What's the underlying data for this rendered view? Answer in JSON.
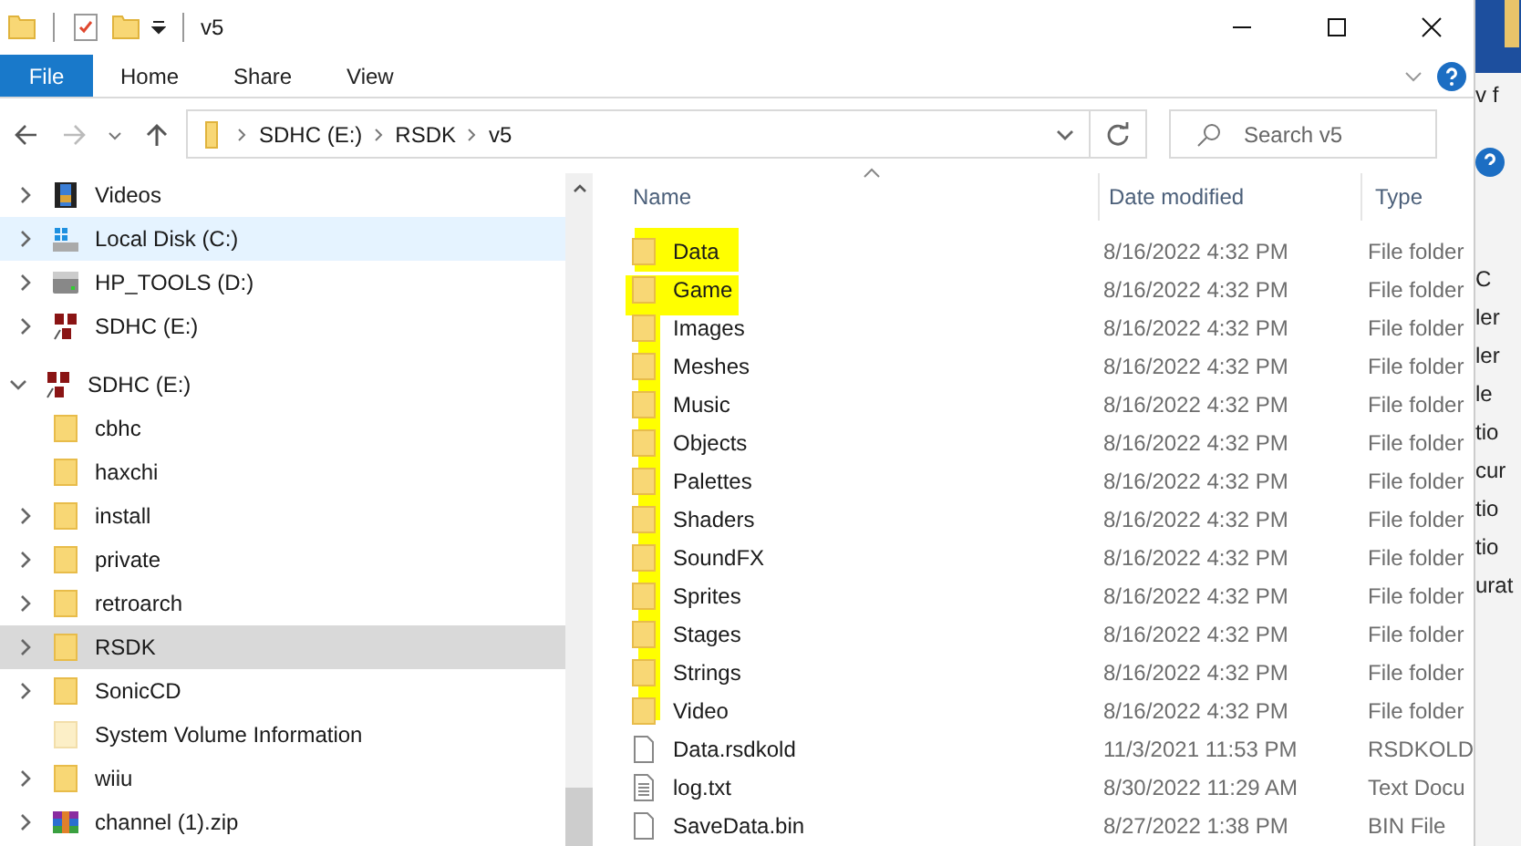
{
  "title_bar": {
    "title": "v5"
  },
  "ribbon": {
    "tabs": [
      {
        "label": "File",
        "kind": "file"
      },
      {
        "label": "Home",
        "kind": "tab"
      },
      {
        "label": "Share",
        "kind": "tab"
      },
      {
        "label": "View",
        "kind": "tab"
      }
    ]
  },
  "address_bar": {
    "path": [
      "SDHC (E:)",
      "RSDK",
      "v5"
    ]
  },
  "search": {
    "placeholder": "Search v5"
  },
  "nav_pane": {
    "groups": [
      [
        {
          "label": "Videos",
          "kind": "video",
          "expandable": true,
          "expanded": false,
          "selected": false,
          "hovered": false
        },
        {
          "label": "Local Disk (C:)",
          "kind": "windrive",
          "expandable": true,
          "expanded": false,
          "selected": false,
          "hovered": true
        },
        {
          "label": "HP_TOOLS (D:)",
          "kind": "drive",
          "expandable": true,
          "expanded": false,
          "selected": false,
          "hovered": false
        },
        {
          "label": "SDHC (E:)",
          "kind": "sd",
          "expandable": true,
          "expanded": false,
          "selected": false,
          "hovered": false
        }
      ],
      [
        {
          "label": "SDHC (E:)",
          "kind": "sd",
          "expandable": true,
          "expanded": true,
          "selected": false,
          "hovered": false,
          "children": [
            {
              "label": "cbhc",
              "kind": "folder",
              "expandable": false,
              "selected": false,
              "hovered": false
            },
            {
              "label": "haxchi",
              "kind": "folder",
              "expandable": false,
              "selected": false,
              "hovered": false
            },
            {
              "label": "install",
              "kind": "folder",
              "expandable": true,
              "expanded": false,
              "selected": false,
              "hovered": false
            },
            {
              "label": "private",
              "kind": "folder",
              "expandable": true,
              "expanded": false,
              "selected": false,
              "hovered": false
            },
            {
              "label": "retroarch",
              "kind": "folder",
              "expandable": true,
              "expanded": false,
              "selected": false,
              "hovered": false
            },
            {
              "label": "RSDK",
              "kind": "folder",
              "expandable": true,
              "expanded": false,
              "selected": true,
              "hovered": false
            },
            {
              "label": "SonicCD",
              "kind": "folder",
              "expandable": true,
              "expanded": false,
              "selected": false,
              "hovered": false
            },
            {
              "label": "System Volume Information",
              "kind": "hidden-folder",
              "expandable": false,
              "selected": false,
              "hovered": false
            },
            {
              "label": "wiiu",
              "kind": "folder",
              "expandable": true,
              "expanded": false,
              "selected": false,
              "hovered": false
            },
            {
              "label": "channel (1).zip",
              "kind": "zip",
              "expandable": true,
              "expanded": false,
              "selected": false,
              "hovered": false
            }
          ]
        }
      ]
    ]
  },
  "file_list": {
    "columns": [
      {
        "label": "Name",
        "sorted": true
      },
      {
        "label": "Date modified",
        "sorted": false
      },
      {
        "label": "Type",
        "sorted": false
      }
    ],
    "rows": [
      {
        "name": "Data",
        "date": "8/16/2022 4:32 PM",
        "type": "File folder",
        "kind": "folder"
      },
      {
        "name": "Game",
        "date": "8/16/2022 4:32 PM",
        "type": "File folder",
        "kind": "folder"
      },
      {
        "name": "Images",
        "date": "8/16/2022 4:32 PM",
        "type": "File folder",
        "kind": "folder"
      },
      {
        "name": "Meshes",
        "date": "8/16/2022 4:32 PM",
        "type": "File folder",
        "kind": "folder"
      },
      {
        "name": "Music",
        "date": "8/16/2022 4:32 PM",
        "type": "File folder",
        "kind": "folder"
      },
      {
        "name": "Objects",
        "date": "8/16/2022 4:32 PM",
        "type": "File folder",
        "kind": "folder"
      },
      {
        "name": "Palettes",
        "date": "8/16/2022 4:32 PM",
        "type": "File folder",
        "kind": "folder"
      },
      {
        "name": "Shaders",
        "date": "8/16/2022 4:32 PM",
        "type": "File folder",
        "kind": "folder"
      },
      {
        "name": "SoundFX",
        "date": "8/16/2022 4:32 PM",
        "type": "File folder",
        "kind": "folder"
      },
      {
        "name": "Sprites",
        "date": "8/16/2022 4:32 PM",
        "type": "File folder",
        "kind": "folder"
      },
      {
        "name": "Stages",
        "date": "8/16/2022 4:32 PM",
        "type": "File folder",
        "kind": "folder"
      },
      {
        "name": "Strings",
        "date": "8/16/2022 4:32 PM",
        "type": "File folder",
        "kind": "folder"
      },
      {
        "name": "Video",
        "date": "8/16/2022 4:32 PM",
        "type": "File folder",
        "kind": "folder"
      },
      {
        "name": "Data.rsdkold",
        "date": "11/3/2021 11:53 PM",
        "type": "RSDKOLD",
        "kind": "file"
      },
      {
        "name": "log.txt",
        "date": "8/30/2022 11:29 AM",
        "type": "Text Docu",
        "kind": "text"
      },
      {
        "name": "SaveData.bin",
        "date": "8/27/2022 1:38 PM",
        "type": "BIN File",
        "kind": "file"
      }
    ]
  },
  "background_window": {
    "texts": [
      "v f",
      "C",
      "ler",
      "ler",
      "le",
      "tio",
      "cur",
      "tio",
      "tio",
      "urat"
    ]
  }
}
